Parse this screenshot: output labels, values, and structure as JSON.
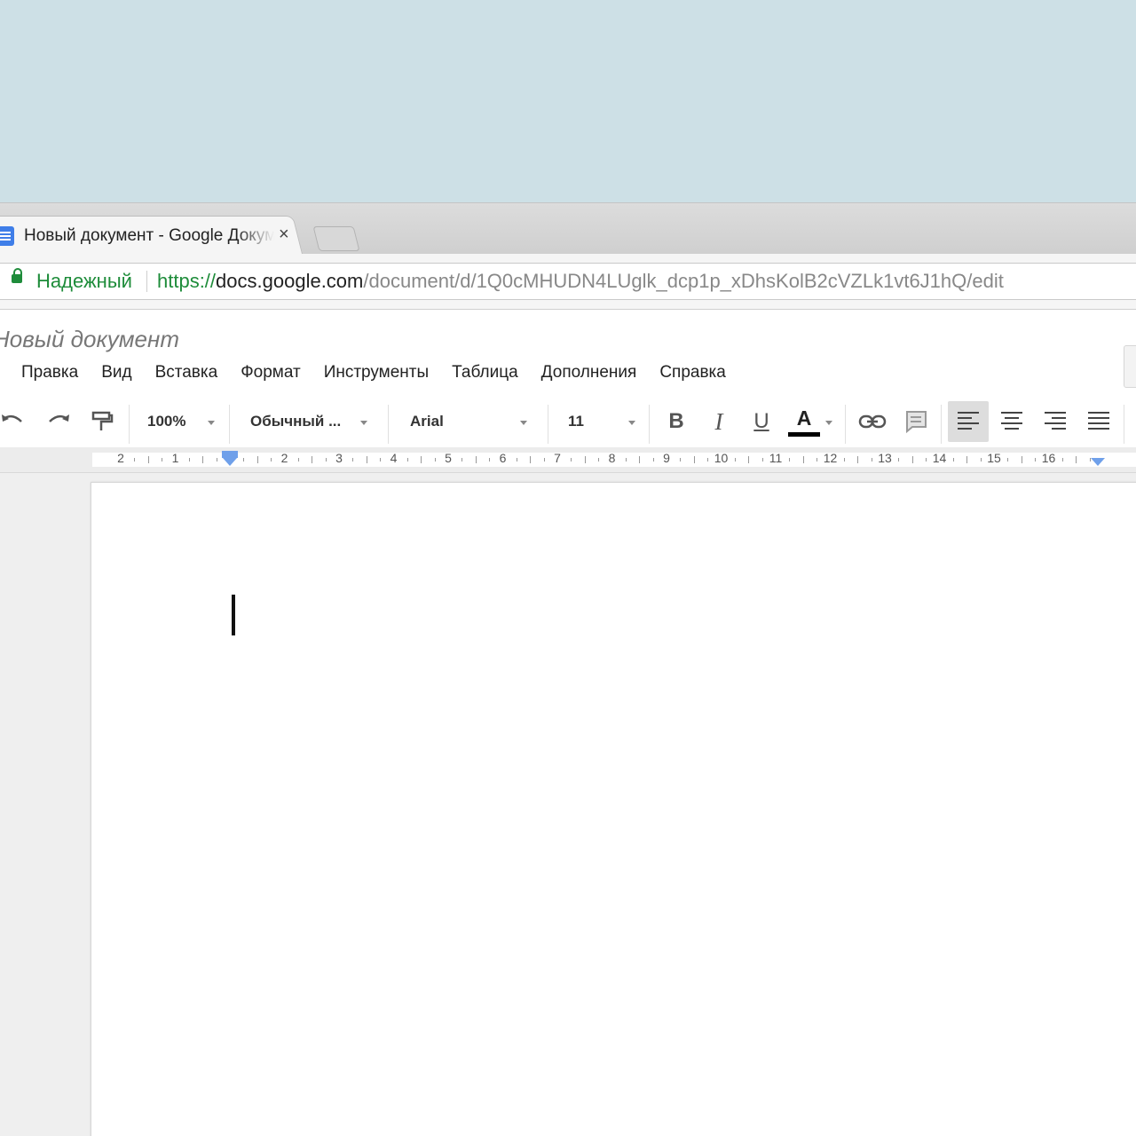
{
  "browser": {
    "tab": {
      "title": "Новый документ - Google Документы",
      "close": "×"
    },
    "address": {
      "security_label": "Надежный",
      "url_scheme": "https://",
      "url_domain": "docs.google.com",
      "url_path": "/document/d/1Q0cMHUDN4LUglk_dcp1p_xDhsKolB2cVZLk1vt6J1hQ/edit"
    }
  },
  "docs": {
    "title": "Новый документ",
    "menu": [
      "Правка",
      "Вид",
      "Вставка",
      "Формат",
      "Инструменты",
      "Таблица",
      "Дополнения",
      "Справка"
    ],
    "toolbar": {
      "zoom": "100%",
      "style": "Обычный ...",
      "font": "Arial",
      "size": "11",
      "bold": "B",
      "italic": "I",
      "underline": "U",
      "text_color": "A",
      "icons": [
        "undo-icon",
        "redo-icon",
        "paint-format-icon",
        "link-icon",
        "comment-icon",
        "align-left-icon",
        "align-center-icon",
        "align-right-icon",
        "align-justify-icon"
      ]
    },
    "ruler": [
      "2",
      "1",
      "1",
      "2",
      "3",
      "4",
      "5",
      "6",
      "7",
      "8",
      "9",
      "10",
      "11",
      "12",
      "13",
      "14",
      "15",
      "16"
    ]
  }
}
